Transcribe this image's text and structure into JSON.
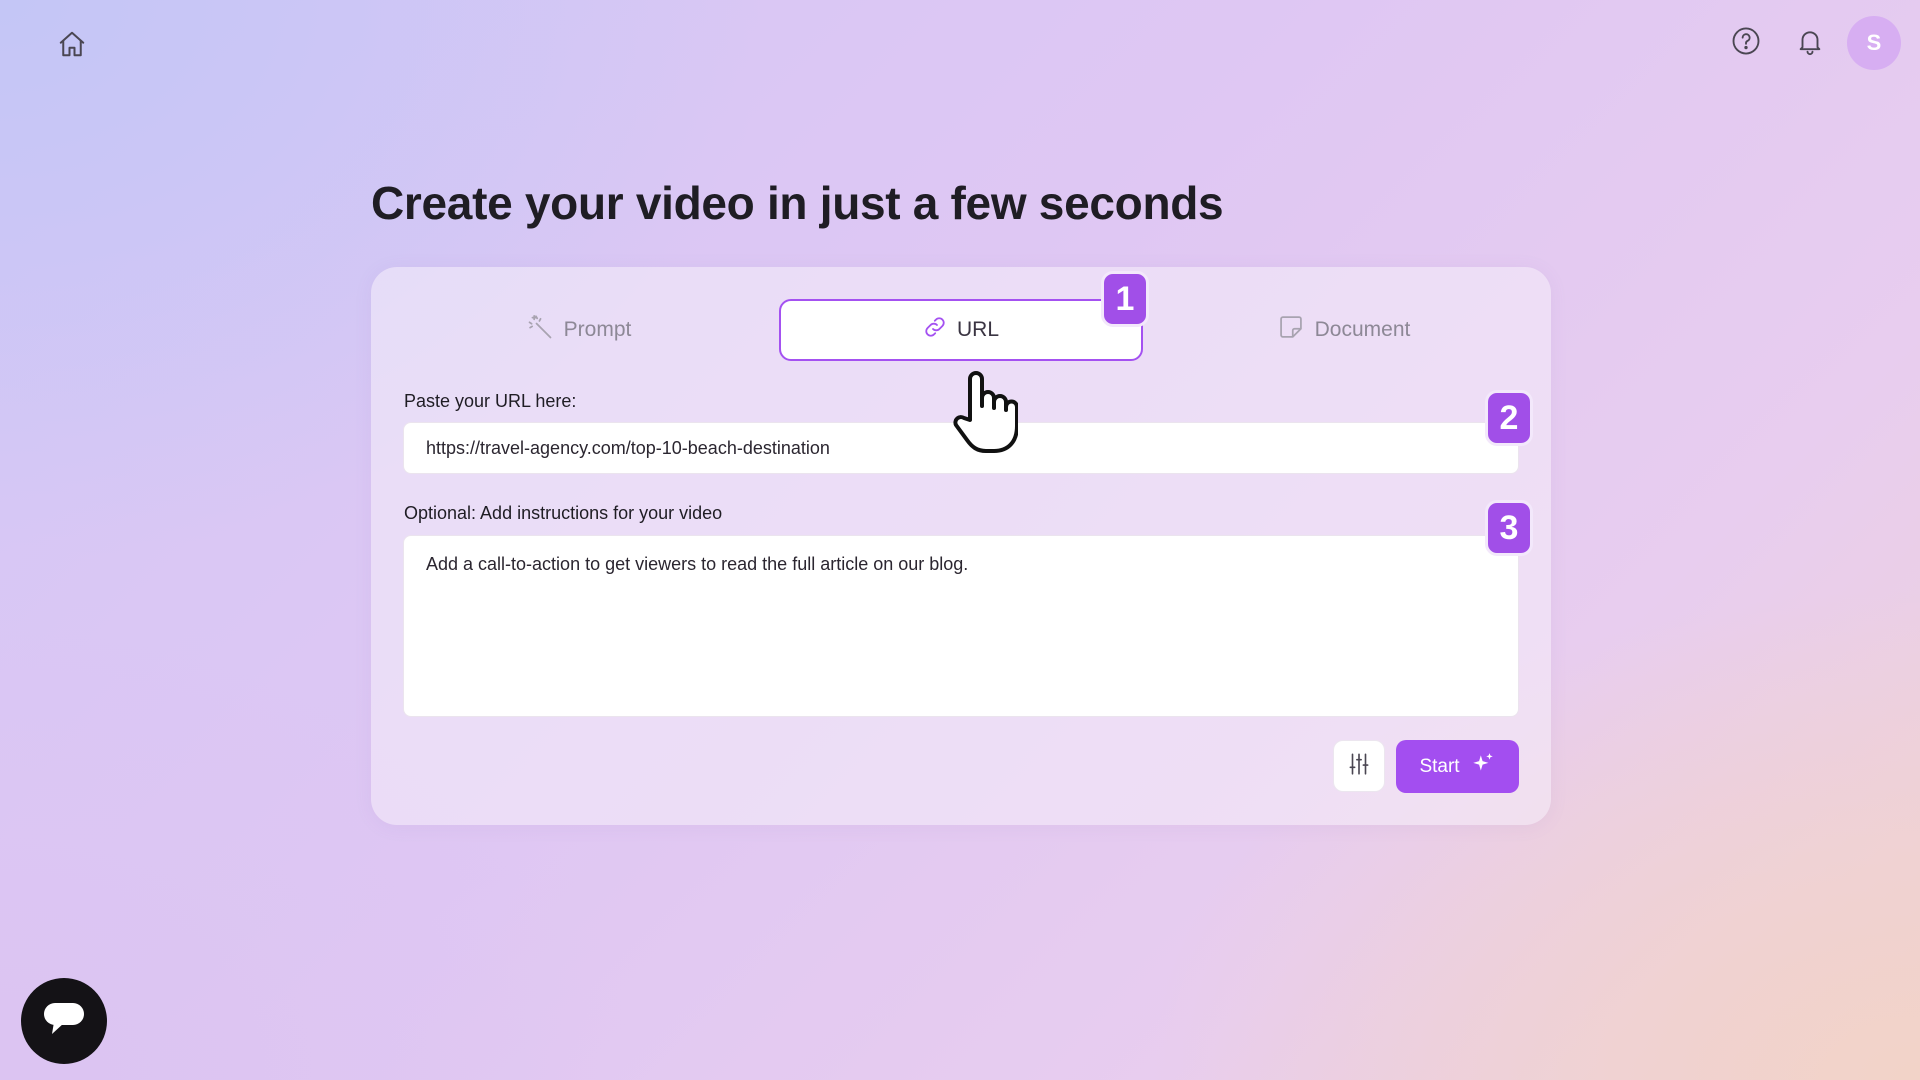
{
  "header": {
    "home_icon": "home-icon",
    "help_icon": "help-circle-icon",
    "notifications_icon": "bell-icon",
    "avatar_initial": "S",
    "avatar_color": "#d7aef2"
  },
  "title": "Create your video in just a few seconds",
  "tabs": [
    {
      "label": "Prompt",
      "icon": "magic-wand-icon",
      "active": false
    },
    {
      "label": "URL",
      "icon": "link-icon",
      "active": true
    },
    {
      "label": "Document",
      "icon": "document-icon",
      "active": false
    }
  ],
  "url_field": {
    "label": "Paste your URL here:",
    "value": "https://travel-agency.com/top-10-beach-destination"
  },
  "instructions_field": {
    "label": "Optional: Add instructions for your video",
    "value": "Add a call-to-action to get viewers to read the full article on our blog."
  },
  "actions": {
    "settings_icon": "sliders-icon",
    "start_label": "Start",
    "start_icon": "sparkles-icon"
  },
  "step_badges": [
    "1",
    "2",
    "3"
  ],
  "chat": {
    "icon": "chat-bubble-icon"
  },
  "colors": {
    "accent": "#a34ef0",
    "badge": "#a14fe8",
    "text": "#1f1d24"
  }
}
